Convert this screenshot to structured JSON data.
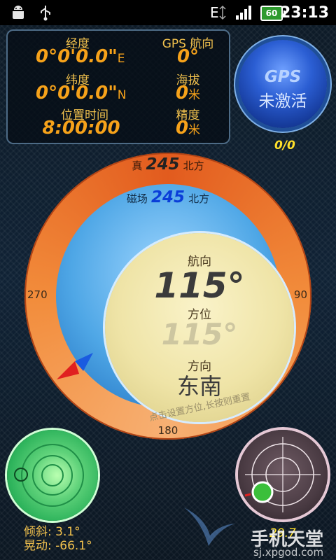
{
  "status_bar": {
    "icons": [
      "android-debug-icon",
      "usb-icon",
      "network-type-icon",
      "signal-icon",
      "battery-icon"
    ],
    "network_type": "E",
    "battery_level": "60",
    "time": "23:13"
  },
  "info_panel": {
    "longitude_label": "经度",
    "longitude_value": "0°0'0.0\"",
    "longitude_dir": "E",
    "heading_label": "GPS 航向",
    "heading_value": "0°",
    "latitude_label": "纬度",
    "latitude_value": "0°0'0.0\"",
    "latitude_dir": "N",
    "altitude_label": "海拔",
    "altitude_value": "0",
    "altitude_unit": "米",
    "time_label": "位置时间",
    "time_value": "8:00:00",
    "accuracy_label": "精度",
    "accuracy_value": "0",
    "accuracy_unit": "米"
  },
  "gps_button": {
    "line1": "GPS",
    "line2": "未激活",
    "satellites": "0/0"
  },
  "compass": {
    "true_prefix": "真",
    "true_value": "245",
    "true_suffix": "北方",
    "mag_prefix": "磁场",
    "mag_value": "245",
    "mag_suffix": "北方",
    "heading_label": "航向",
    "heading_value": "115°",
    "bearing_label": "方位",
    "bearing_value": "115°",
    "direction_label": "方向",
    "direction_value": "东南",
    "hint": "点击设置方位,长按则重置",
    "tick_labels": {
      "w": "270",
      "e": "90",
      "s": "180"
    }
  },
  "level": {
    "tilt_label": "倾斜:",
    "tilt_value": "3.1°",
    "shake_label": "晃动:",
    "shake_value": "-66.1°"
  },
  "radar": {
    "reading": "29.7"
  },
  "watermark": {
    "brand": "手机天堂",
    "url": "sj.xpgod.com"
  },
  "colors": {
    "label_gold": "#f1c14d",
    "value_orange": "#f6a21a",
    "gps_blue": "#2b5ed3",
    "sat_yellow": "#ffe02a",
    "compass_orange": "#e25b1e",
    "compass_blue": "#4fa7e6",
    "face_cream": "#efe4a7",
    "level_green": "#2db35b"
  }
}
